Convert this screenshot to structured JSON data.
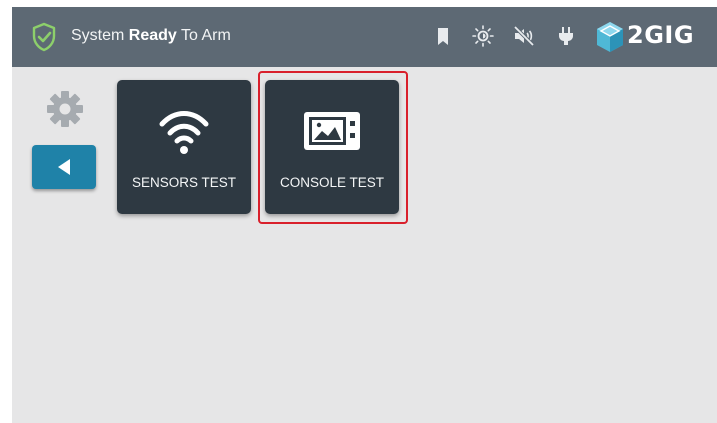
{
  "status_bar": {
    "status_prefix": "System",
    "status_bold": "Ready",
    "status_suffix": "To Arm",
    "icons": [
      "shield-check-icon",
      "bookmark-icon",
      "brightness-icon",
      "speaker-muted-icon",
      "power-plug-icon"
    ],
    "brand": "2GIG"
  },
  "sidebar": {
    "icons": [
      "gear-icon",
      "back-arrow-icon"
    ]
  },
  "tiles": [
    {
      "label": "SENSORS TEST",
      "icon": "wifi-icon"
    },
    {
      "label": "CONSOLE TEST",
      "icon": "console-display-icon"
    }
  ],
  "colors": {
    "topbar": "#5d6974",
    "background": "#e6e6e7",
    "tile": "#2e3942",
    "back_button": "#1f82a8",
    "status_ok": "#8dcf6b",
    "brand_cube": "#4fb8d6",
    "highlight": "#d9202c"
  }
}
